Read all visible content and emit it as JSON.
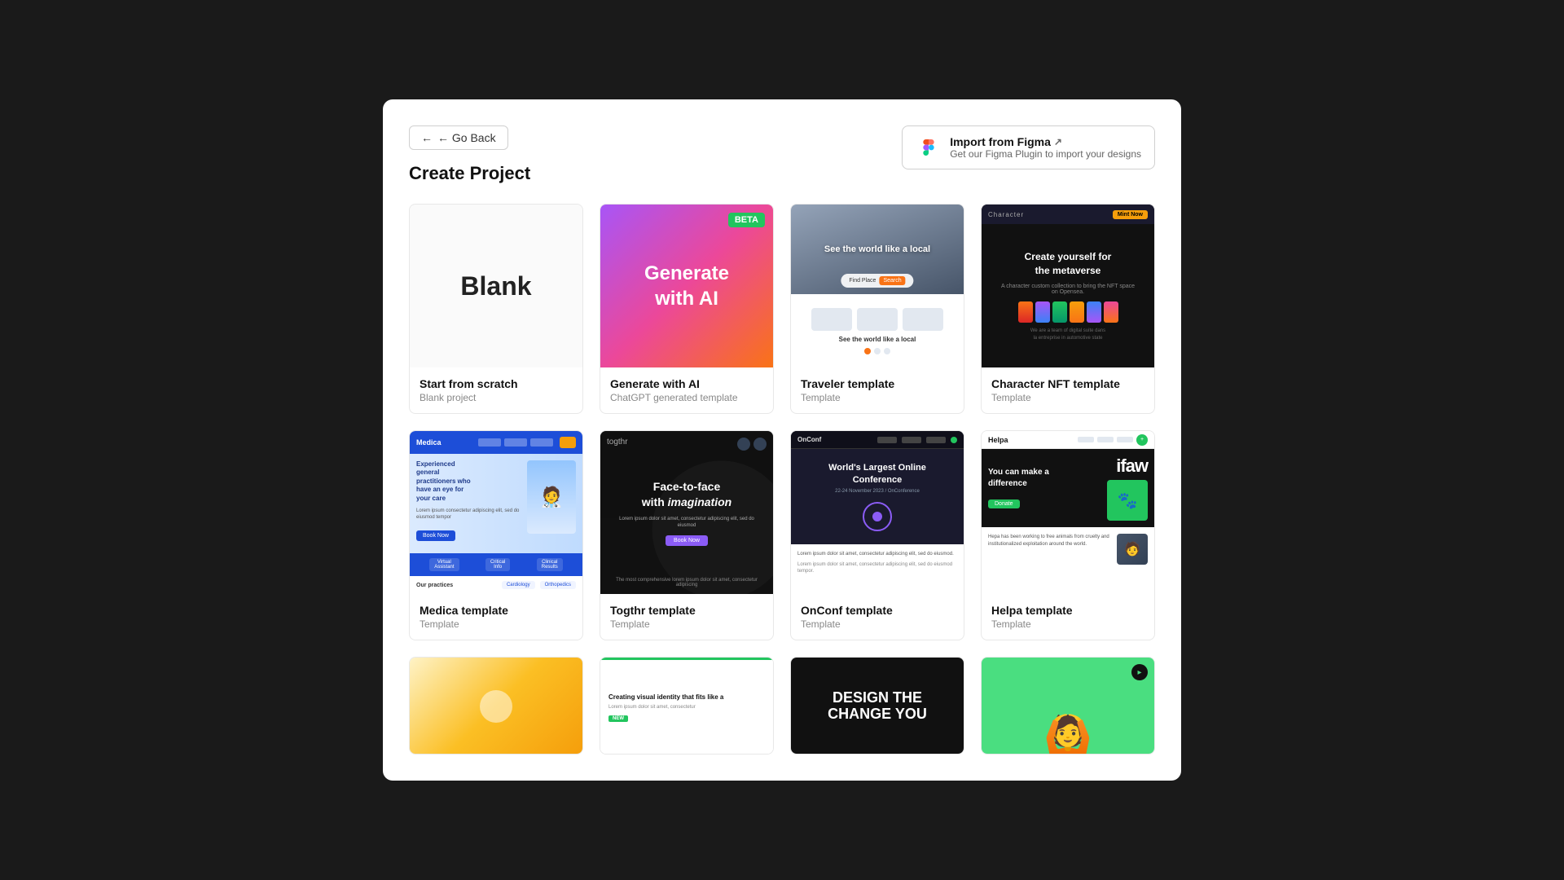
{
  "header": {
    "go_back_label": "← Go Back",
    "page_title": "Create Project",
    "figma_import_label": "Import from Figma",
    "figma_import_sub": "Get our Figma Plugin to import your designs",
    "external_icon": "↗"
  },
  "cards": [
    {
      "id": "blank",
      "title": "Start from scratch",
      "subtitle": "Blank project",
      "thumb_type": "blank",
      "thumb_text": "Blank"
    },
    {
      "id": "ai",
      "title": "Generate with AI",
      "subtitle": "ChatGPT generated template",
      "thumb_type": "ai",
      "thumb_text": "Generate\nwith AI",
      "badge": "BETA"
    },
    {
      "id": "traveler",
      "title": "Traveler template",
      "subtitle": "Template",
      "thumb_type": "traveler",
      "thumb_top_text": "See the world like a local",
      "thumb_bottom_text": "See the world like a local"
    },
    {
      "id": "nft",
      "title": "Character NFT template",
      "subtitle": "Template",
      "thumb_type": "nft",
      "thumb_text": "Create yourself for\nthe metaverse"
    },
    {
      "id": "medica",
      "title": "Medica template",
      "subtitle": "Template",
      "thumb_type": "medica"
    },
    {
      "id": "togthr",
      "title": "Togthr template",
      "subtitle": "Template",
      "thumb_type": "togthr",
      "thumb_text": "Face-to-face\nwith imagination"
    },
    {
      "id": "onconf",
      "title": "OnConf template",
      "subtitle": "Template",
      "thumb_type": "onconf",
      "thumb_title": "World's Largest Online Conference",
      "thumb_sub": "22-24 November 2023 / OnConference"
    },
    {
      "id": "helpa",
      "title": "Helpa template",
      "subtitle": "Template",
      "thumb_type": "helpa",
      "thumb_hero_text": "You can make a difference"
    },
    {
      "id": "partial1",
      "title": "",
      "subtitle": "",
      "thumb_type": "partial-yellow"
    },
    {
      "id": "partial2",
      "title": "",
      "subtitle": "",
      "thumb_type": "partial-text",
      "thumb_text": "Creating visual identity that fits like a..."
    },
    {
      "id": "partial3",
      "title": "",
      "subtitle": "",
      "thumb_type": "partial-dark",
      "thumb_text": "DESIGN THE\nCHANGE YOU"
    },
    {
      "id": "partial4",
      "title": "",
      "subtitle": "",
      "thumb_type": "partial-green"
    }
  ]
}
